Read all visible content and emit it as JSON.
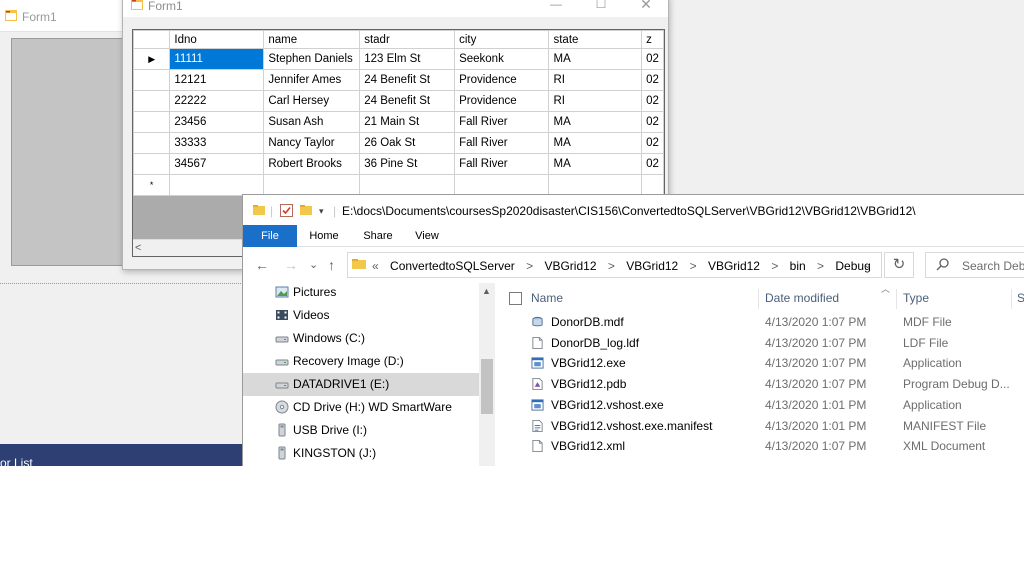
{
  "background_window": {
    "title": "Form1",
    "bottom_bar_text": "or List"
  },
  "form1": {
    "title": "Form1",
    "caption_buttons": {
      "minimize": "—",
      "maximize": "☐",
      "close": "✕"
    },
    "grid": {
      "columns": [
        "Idno",
        "name",
        "stadr",
        "city",
        "state",
        "z"
      ],
      "rows": [
        {
          "marker": "▶",
          "cells": [
            "11111",
            "Stephen Daniels",
            "123 Elm St",
            "Seekonk",
            "MA",
            "02"
          ]
        },
        {
          "marker": "",
          "cells": [
            "12121",
            "Jennifer Ames",
            "24 Benefit St",
            "Providence",
            "RI",
            "02"
          ]
        },
        {
          "marker": "",
          "cells": [
            "22222",
            "Carl Hersey",
            "24 Benefit St",
            "Providence",
            "RI",
            "02"
          ]
        },
        {
          "marker": "",
          "cells": [
            "23456",
            "Susan Ash",
            "21 Main St",
            "Fall River",
            "MA",
            "02"
          ]
        },
        {
          "marker": "",
          "cells": [
            "33333",
            "Nancy Taylor",
            "26 Oak St",
            "Fall River",
            "MA",
            "02"
          ]
        },
        {
          "marker": "",
          "cells": [
            "34567",
            "Robert Brooks",
            "36 Pine St",
            "Fall River",
            "MA",
            "02"
          ]
        },
        {
          "marker": "*",
          "cells": [
            "",
            "",
            "",
            "",
            "",
            ""
          ]
        }
      ],
      "scroll_left": "<"
    }
  },
  "explorer": {
    "title_path": "E:\\docs\\Documents\\coursesSp2020disaster\\CIS156\\ConvertedtoSQLServer\\VBGrid12\\VBGrid12\\VBGrid12\\",
    "ribbon_tabs": [
      "File",
      "Home",
      "Share",
      "View"
    ],
    "nav_buttons": {
      "back": "←",
      "forward": "→",
      "recent": "⌄",
      "up": "↑"
    },
    "address": {
      "lead": "«",
      "crumbs": [
        "ConvertedtoSQLServer",
        "VBGrid12",
        "VBGrid12",
        "VBGrid12",
        "bin",
        "Debug"
      ],
      "separator": ">",
      "dropdown": "⌄",
      "refresh": "↻"
    },
    "search_placeholder": "Search Deb",
    "nav_items": [
      {
        "label": "Pictures",
        "icon": "pictures-icon",
        "active": false
      },
      {
        "label": "Videos",
        "icon": "videos-icon",
        "active": false
      },
      {
        "label": "Windows (C:)",
        "icon": "drive-icon",
        "active": false
      },
      {
        "label": "Recovery Image (D:)",
        "icon": "drive-icon",
        "active": false
      },
      {
        "label": "DATADRIVE1 (E:)",
        "icon": "drive-icon",
        "active": true
      },
      {
        "label": "CD Drive (H:) WD SmartWare",
        "icon": "cd-drive-icon",
        "active": false
      },
      {
        "label": "USB Drive (I:)",
        "icon": "usb-drive-icon",
        "active": false
      },
      {
        "label": "KINGSTON (J:)",
        "icon": "usb-drive-icon",
        "active": false
      }
    ],
    "columns": {
      "name": "Name",
      "date": "Date modified",
      "type": "Type",
      "size": "S"
    },
    "files": [
      {
        "name": "DonorDB.mdf",
        "date": "4/13/2020 1:07 PM",
        "type": "MDF File",
        "icon": "database-file-icon"
      },
      {
        "name": "DonorDB_log.ldf",
        "date": "4/13/2020 1:07 PM",
        "type": "LDF File",
        "icon": "generic-file-icon"
      },
      {
        "name": "VBGrid12.exe",
        "date": "4/13/2020 1:07 PM",
        "type": "Application",
        "icon": "application-icon"
      },
      {
        "name": "VBGrid12.pdb",
        "date": "4/13/2020 1:07 PM",
        "type": "Program Debug D...",
        "icon": "pdb-file-icon"
      },
      {
        "name": "VBGrid12.vshost.exe",
        "date": "4/13/2020 1:01 PM",
        "type": "Application",
        "icon": "application-icon"
      },
      {
        "name": "VBGrid12.vshost.exe.manifest",
        "date": "4/13/2020 1:01 PM",
        "type": "MANIFEST File",
        "icon": "manifest-file-icon"
      },
      {
        "name": "VBGrid12.xml",
        "date": "4/13/2020 1:07 PM",
        "type": "XML Document",
        "icon": "generic-file-icon"
      }
    ]
  }
}
